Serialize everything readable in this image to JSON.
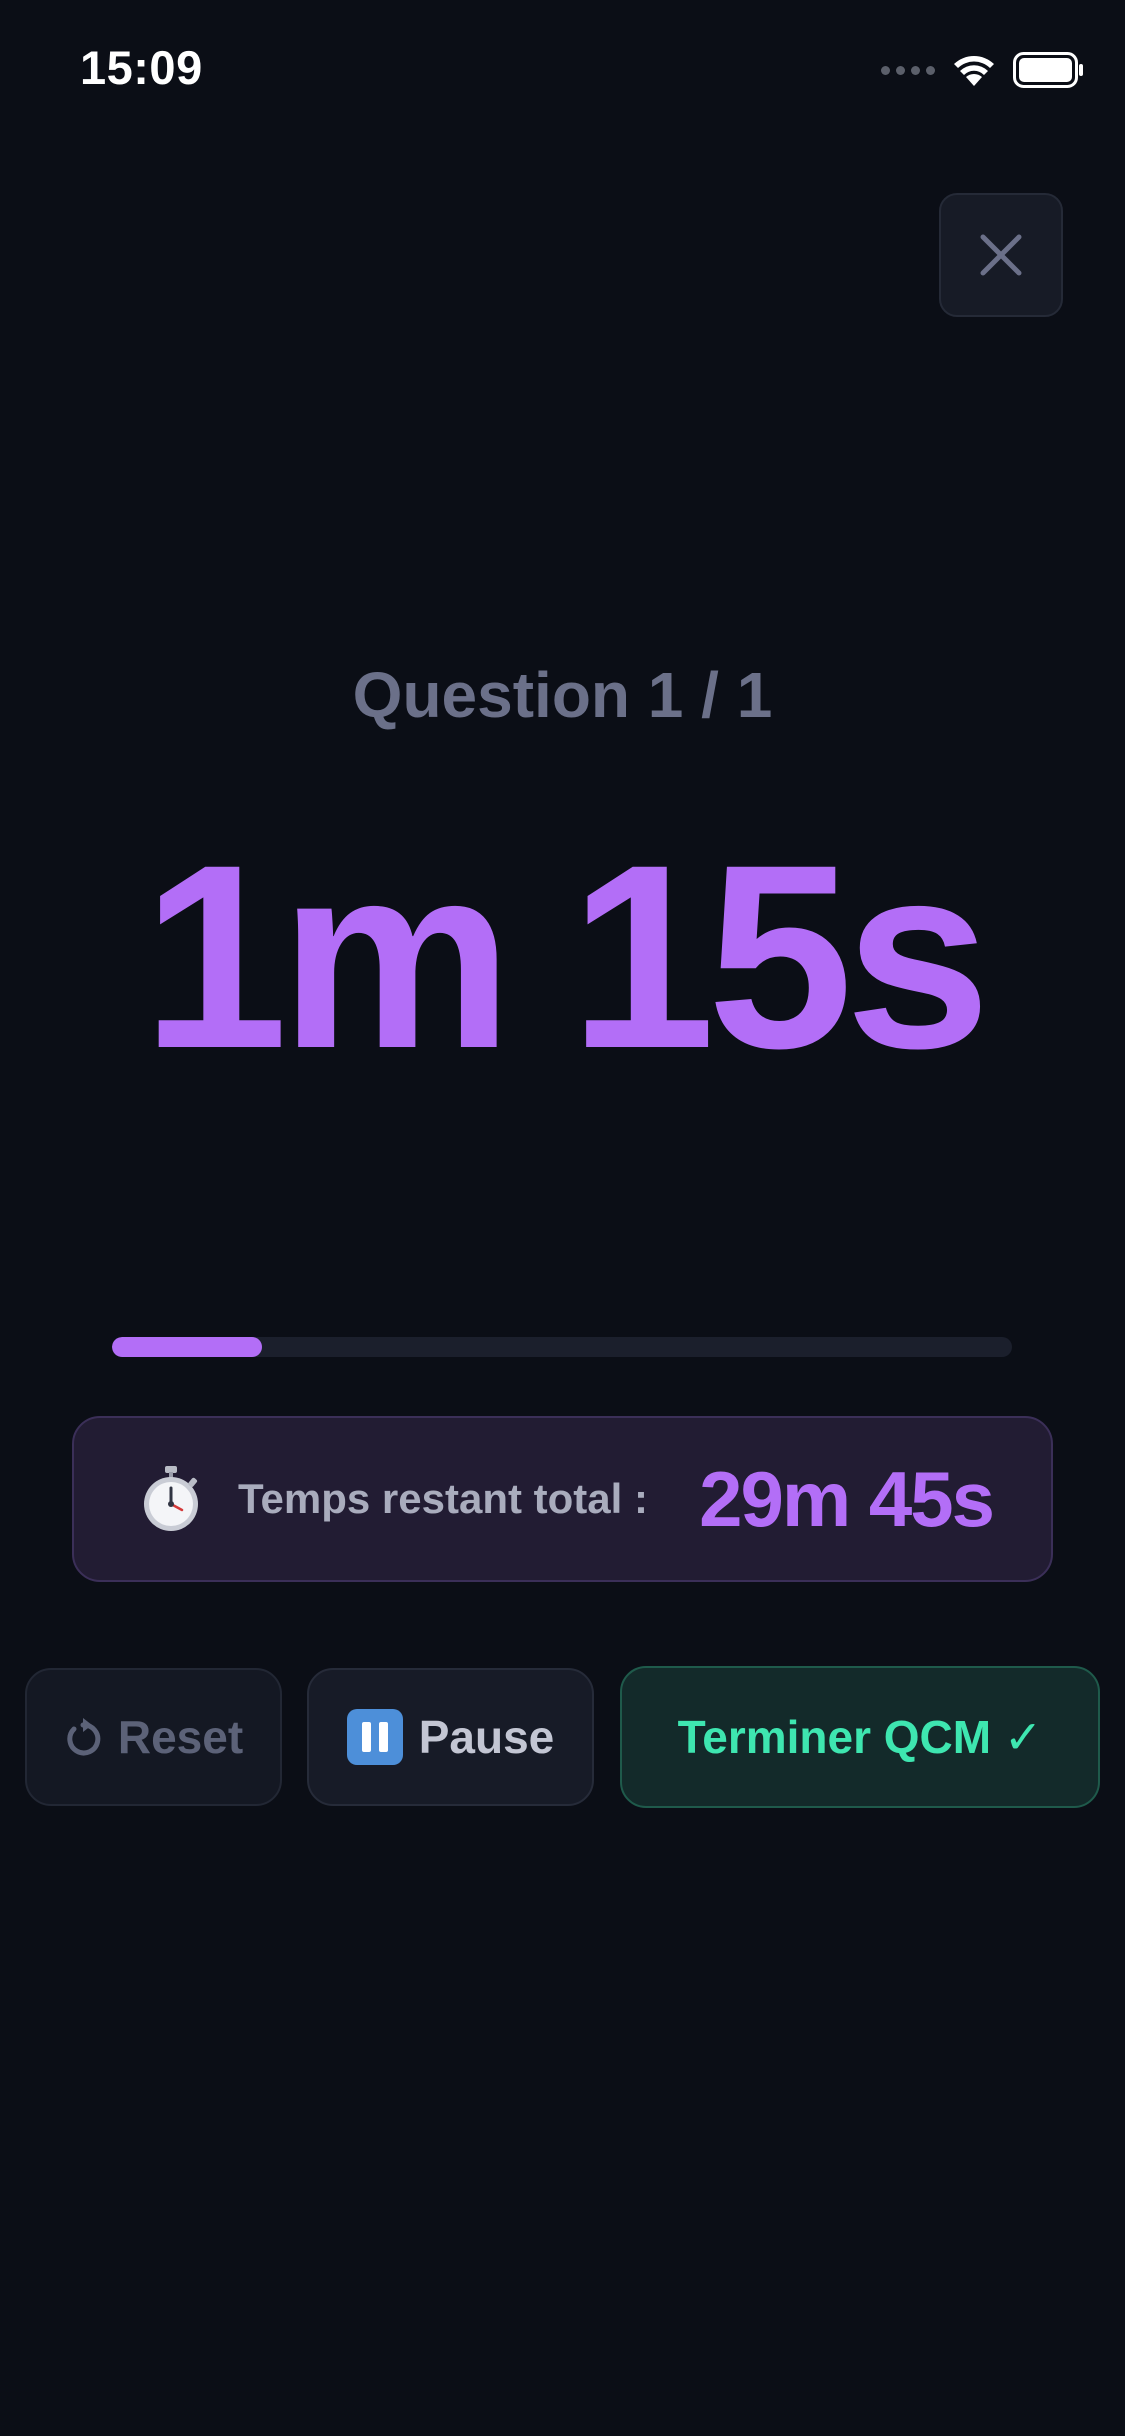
{
  "status_bar": {
    "time": "15:09"
  },
  "header": {
    "close_icon": "close-icon"
  },
  "quiz": {
    "question_label": "Question 1 / 1",
    "remaining_time": "1m 15s",
    "progress_fraction": 0.167
  },
  "total": {
    "icon": "stopwatch-icon",
    "label": "Temps restant total :",
    "value": "29m 45s"
  },
  "actions": {
    "reset_label": "Reset",
    "reset_icon": "reset-icon",
    "pause_label": "Pause",
    "pause_icon": "pause-icon",
    "finish_label": "Terminer QCM ✓"
  },
  "colors": {
    "background": "#0b0e16",
    "accent": "#b36ef7",
    "success": "#3ee6b0",
    "muted": "#6b7089"
  }
}
